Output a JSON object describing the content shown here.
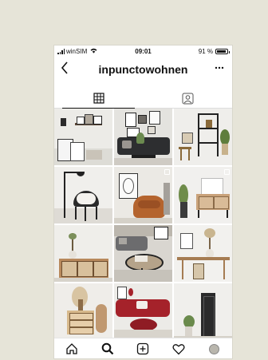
{
  "status": {
    "carrier": "winSIM",
    "time": "09:01",
    "battery": "91 %",
    "battery_level": 0.91
  },
  "header": {
    "back_icon": "chevron-left-icon",
    "username": "inpunctowohnen",
    "more_icon": "more-dots-icon"
  },
  "tabs": [
    {
      "icon": "grid-icon",
      "active": true
    },
    {
      "icon": "tagged-person-icon",
      "active": false
    }
  ],
  "posts": [
    {
      "scene": "wall-shelf-frames",
      "multi": false
    },
    {
      "scene": "dark-sofa-gallery-wall",
      "multi": false
    },
    {
      "scene": "shelf-stool-plants",
      "multi": false
    },
    {
      "scene": "floor-lamp-chair",
      "multi": false
    },
    {
      "scene": "cognac-chair-art",
      "multi": true
    },
    {
      "scene": "sideboard-plant",
      "multi": true
    },
    {
      "scene": "cane-sideboard-vase",
      "multi": false
    },
    {
      "scene": "grey-sofa-coffee-table",
      "multi": false
    },
    {
      "scene": "dining-table-dried-flowers",
      "multi": false
    },
    {
      "scene": "dresser-pampas",
      "multi": false
    },
    {
      "scene": "red-sofa-ottoman",
      "multi": false
    },
    {
      "scene": "black-cabinet-plant",
      "multi": false
    }
  ],
  "bottom_nav": [
    {
      "icon": "home-icon"
    },
    {
      "icon": "search-icon"
    },
    {
      "icon": "add-post-icon"
    },
    {
      "icon": "heart-icon"
    },
    {
      "icon": "profile-avatar"
    }
  ],
  "colors": {
    "background": "#e6e4d8",
    "sofa_red": "#a5222a",
    "chair_cognac": "#b4642e"
  }
}
